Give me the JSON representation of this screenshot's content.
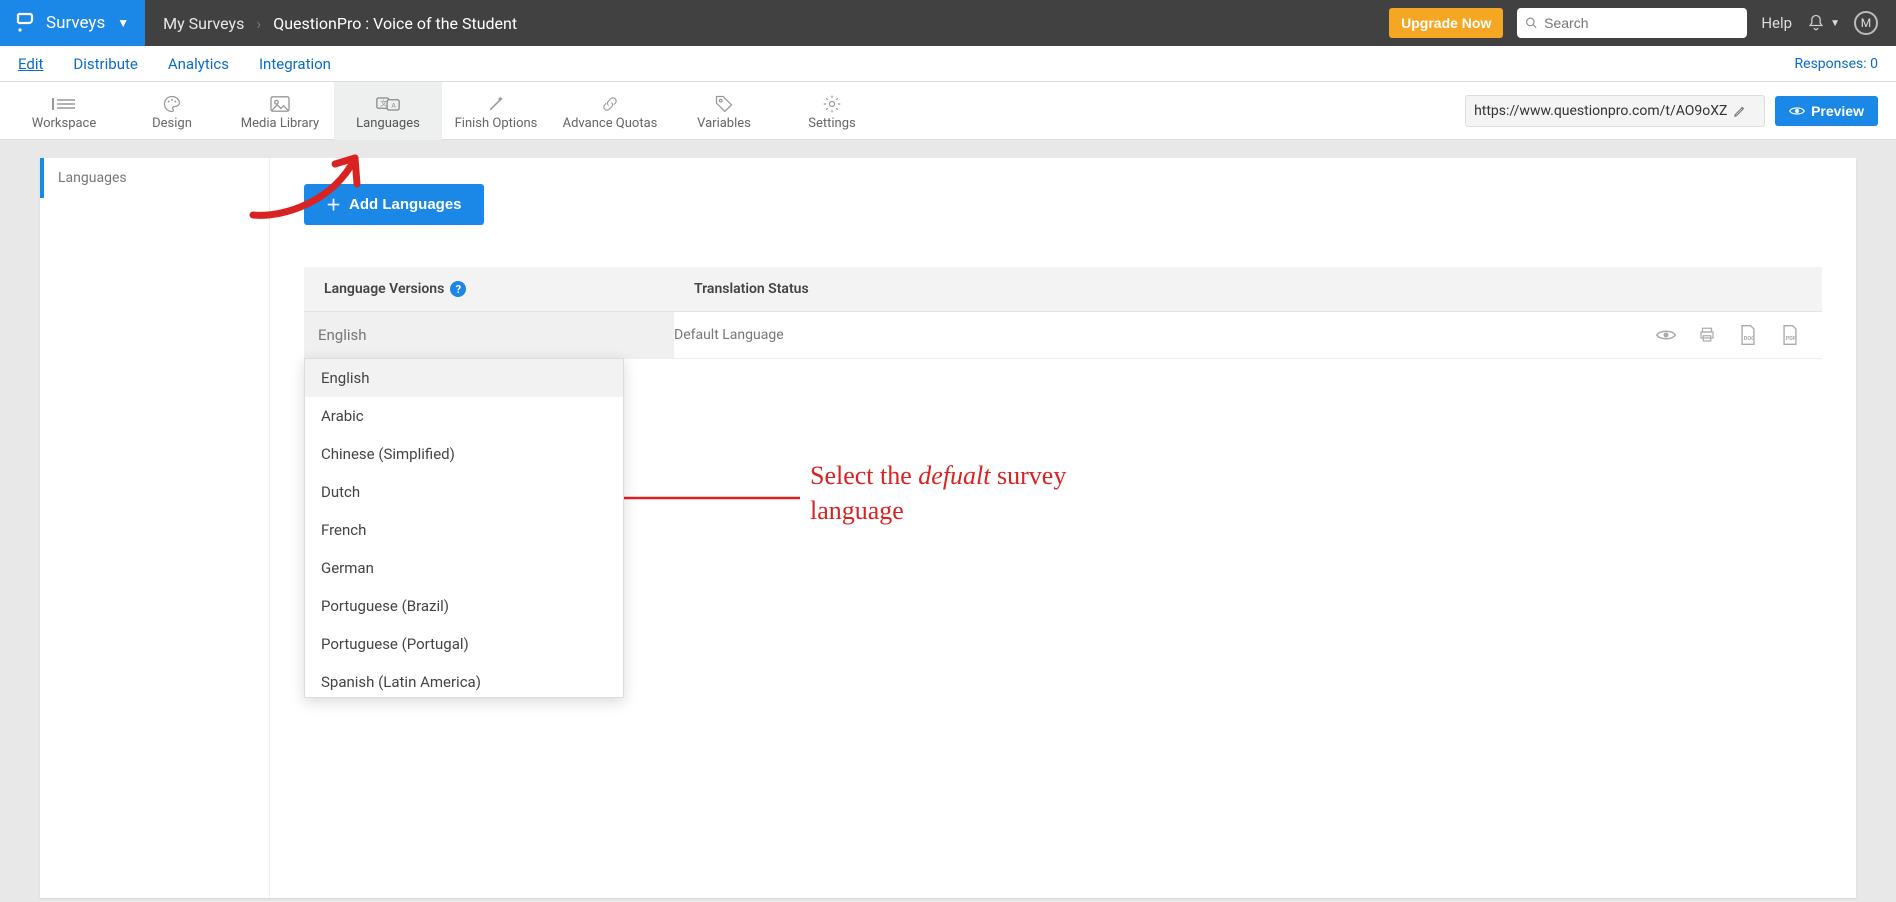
{
  "topbar": {
    "brand_label": "Surveys",
    "breadcrumb_root": "My Surveys",
    "breadcrumb_current": "QuestionPro : Voice of the Student",
    "upgrade_label": "Upgrade Now",
    "search_placeholder": "Search",
    "help_label": "Help",
    "avatar_letter": "M"
  },
  "subnav": {
    "items": [
      "Edit",
      "Distribute",
      "Analytics",
      "Integration"
    ],
    "responses_label": "Responses: 0"
  },
  "toolbar": {
    "items": [
      {
        "label": "Workspace"
      },
      {
        "label": "Design"
      },
      {
        "label": "Media Library"
      },
      {
        "label": "Languages"
      },
      {
        "label": "Finish Options"
      },
      {
        "label": "Advance Quotas"
      },
      {
        "label": "Variables"
      },
      {
        "label": "Settings"
      }
    ],
    "url_value": "https://www.questionpro.com/t/AO9oXZ",
    "preview_label": "Preview"
  },
  "sidebar": {
    "tab_label": "Languages"
  },
  "content": {
    "add_btn_label": "Add Languages",
    "col_lang": "Language Versions",
    "col_status": "Translation Status",
    "selected_language": "English",
    "default_status": "Default Language",
    "dropdown_options": [
      "English",
      "Arabic",
      "Chinese (Simplified)",
      "Dutch",
      "French",
      "German",
      "Portuguese (Brazil)",
      "Portuguese (Portugal)",
      "Spanish (Latin America)"
    ]
  },
  "annotation": {
    "line1_pre": "Select the ",
    "line1_it": "defualt",
    "line1_post": " survey",
    "line2": "language"
  }
}
